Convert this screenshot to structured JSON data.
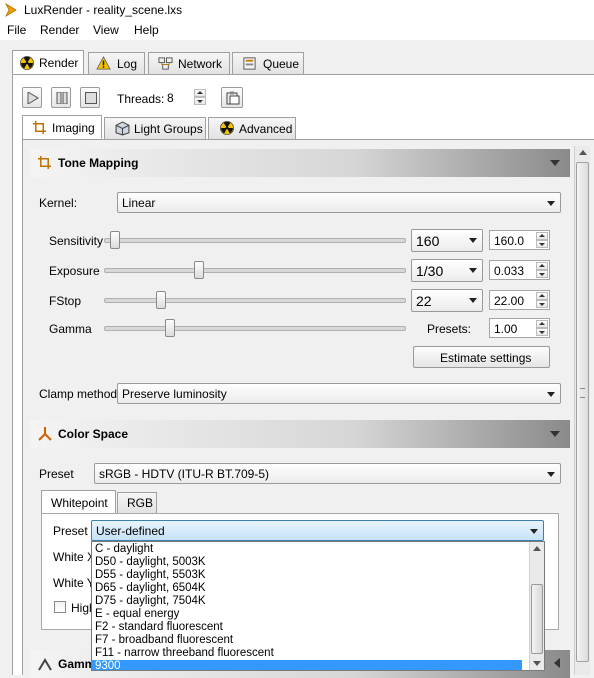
{
  "window": {
    "title": "LuxRender - reality_scene.lxs"
  },
  "menu": [
    "File",
    "Render",
    "View",
    "Help"
  ],
  "main_tabs": [
    {
      "label": "Render",
      "icon": "radiation-icon"
    },
    {
      "label": "Log",
      "icon": "warning-icon"
    },
    {
      "label": "Network",
      "icon": "network-icon"
    },
    {
      "label": "Queue",
      "icon": "queue-icon"
    }
  ],
  "toolbar": {
    "threads_label": "Threads:",
    "threads_value": "8"
  },
  "sub_tabs": [
    {
      "label": "Imaging",
      "icon": "crop-icon"
    },
    {
      "label": "Light Groups",
      "icon": "cube-icon"
    },
    {
      "label": "Advanced",
      "icon": "radiation-icon"
    }
  ],
  "tone_mapping": {
    "title": "Tone Mapping",
    "kernel_label": "Kernel:",
    "kernel_value": "Linear",
    "sliders": [
      {
        "label": "Sensitivity",
        "preset": "160",
        "value": "160.0",
        "position": 0.02
      },
      {
        "label": "Exposure",
        "preset": "1/30",
        "value": "0.033",
        "position": 0.31
      },
      {
        "label": "FStop",
        "preset": "22",
        "value": "22.00",
        "position": 0.18
      },
      {
        "label": "Gamma",
        "preset": "",
        "value": "1.00",
        "position": 0.21
      }
    ],
    "presets_label": "Presets:",
    "estimate_button": "Estimate settings",
    "clamp_label": "Clamp method:",
    "clamp_value": "Preserve luminosity"
  },
  "color_space": {
    "title": "Color Space",
    "preset_label": "Preset",
    "preset_value": "sRGB - HDTV (ITU-R BT.709-5)",
    "tabs": [
      "Whitepoint",
      "RGB"
    ],
    "wp_preset_label": "Preset",
    "wp_preset_value": "User-defined",
    "white_x_label": "White X",
    "white_y_label": "White Y",
    "high_label": "High",
    "dropdown_items": [
      "C - daylight",
      "D50 - daylight, 5003K",
      "D55 - daylight, 5503K",
      "D65 - daylight, 6504K",
      "D75 - daylight, 7504K",
      "E - equal energy",
      "F2 - standard fluorescent",
      "F7 - broadband fluorescent",
      "F11 - narrow threeband fluorescent",
      "9300"
    ],
    "selected_index": 9
  },
  "gamma_section": {
    "title": "Gamma"
  },
  "colors": {
    "selection": "#3399ff",
    "accent_icon": "#e8a000"
  }
}
